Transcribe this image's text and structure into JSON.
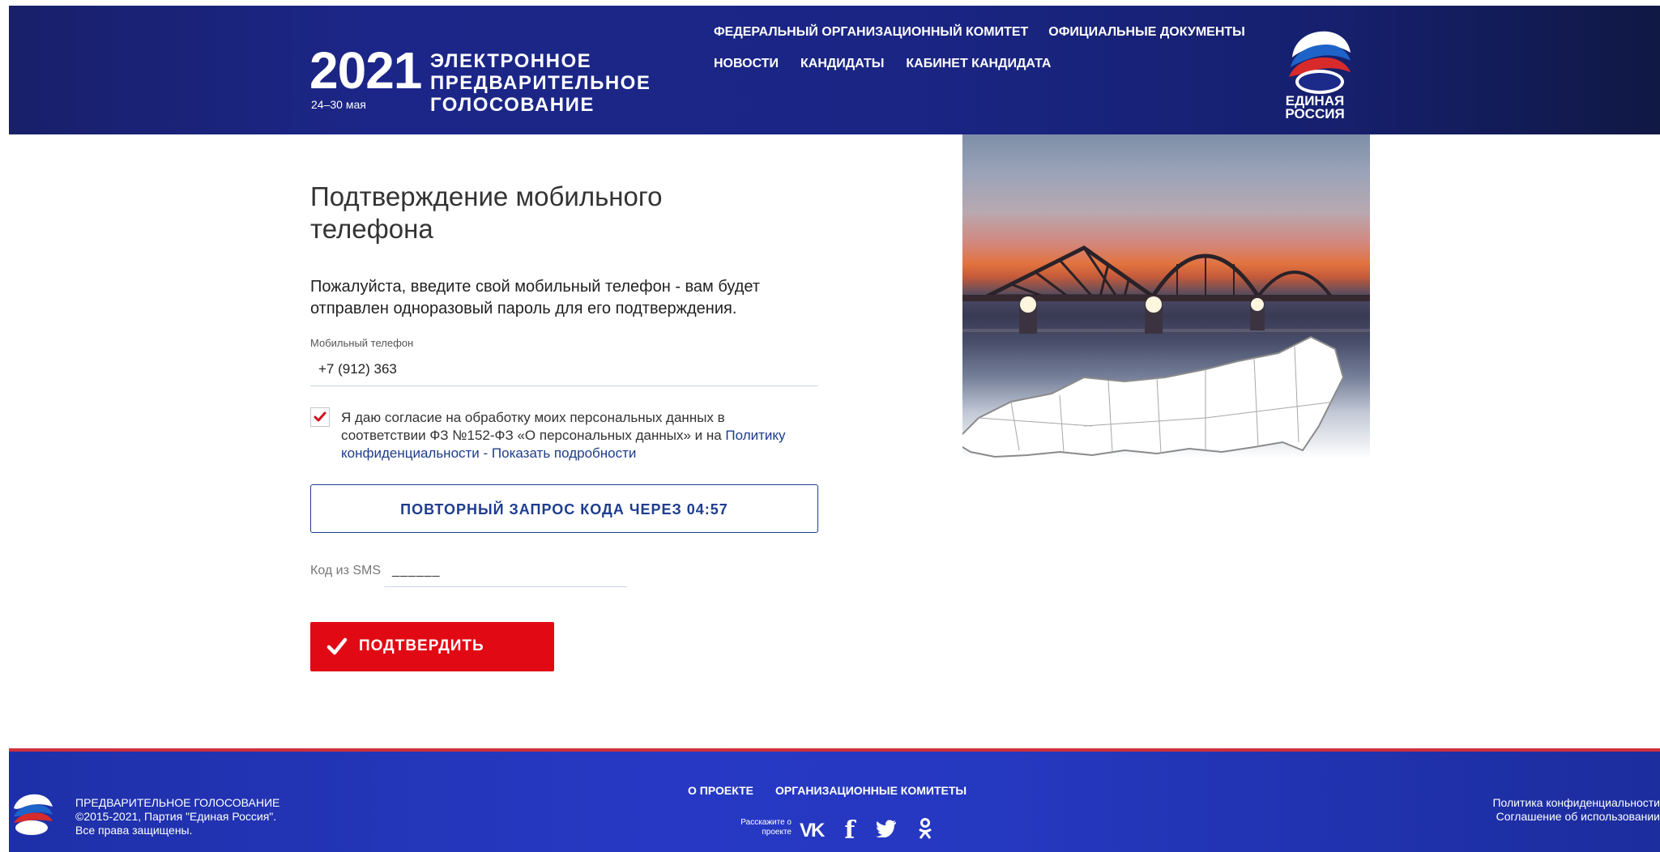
{
  "header": {
    "year": "2021",
    "dates": "24–30 мая",
    "title_lines": [
      "ЭЛЕКТРОННОЕ",
      "ПРЕДВАРИТЕЛЬНОЕ",
      "ГОЛОСОВАНИЕ"
    ],
    "nav_row1": [
      "ФЕДЕРАЛЬНЫЙ ОРГАНИЗАЦИОННЫЙ КОМИТЕТ",
      "ОФИЦИАЛЬНЫЕ ДОКУМЕНТЫ"
    ],
    "nav_row2": [
      "НОВОСТИ",
      "КАНДИДАТЫ",
      "КАБИНЕТ КАНДИДАТА"
    ],
    "party_logo_text": [
      "ЕДИНАЯ",
      "РОССИЯ"
    ]
  },
  "main": {
    "title": "Подтверждение мобильного телефона",
    "intro": "Пожалуйста, введите свой мобильный телефон - вам будет отправлен одноразовый пароль для его подтверждения.",
    "phone_label": "Мобильный телефон",
    "phone_value": "+7 (912) 363",
    "consent_checked": true,
    "consent_text": "Я даю согласие на обработку моих персональных данных в соответствии ФЗ №152-ФЗ «О персональных данных» и на",
    "privacy_link": "Политику конфиденциальности",
    "details_link": "- Показать подробности",
    "resend_button": "ПОВТОРНЫЙ ЗАПРОС КОДА ЧЕРЕЗ 04:57",
    "sms_label": "Код из SMS",
    "sms_mask": "______",
    "confirm_button": "ПОДТВЕРДИТЬ"
  },
  "footer": {
    "org_lines": [
      "ПРЕДВАРИТЕЛЬНОЕ ГОЛОСОВАНИЕ",
      "©2015-2021, Партия \"Единая Россия\".",
      "Все права защищены."
    ],
    "nav": [
      "О ПРОЕКТЕ",
      "ОРГАНИЗАЦИОННЫЕ КОМИТЕТЫ"
    ],
    "share_label": [
      "Расскажите о",
      "проекте"
    ],
    "social_icons": [
      "vk-icon",
      "facebook-icon",
      "twitter-icon",
      "odnoklassniki-icon"
    ],
    "legal_links": [
      "Политика конфиденциальности",
      "Соглашение об использовании"
    ]
  },
  "colors": {
    "header_bg": "#1c2688",
    "footer_bg": "#2739c4",
    "accent_red": "#e10a14",
    "link_blue": "#1d3c8a"
  }
}
